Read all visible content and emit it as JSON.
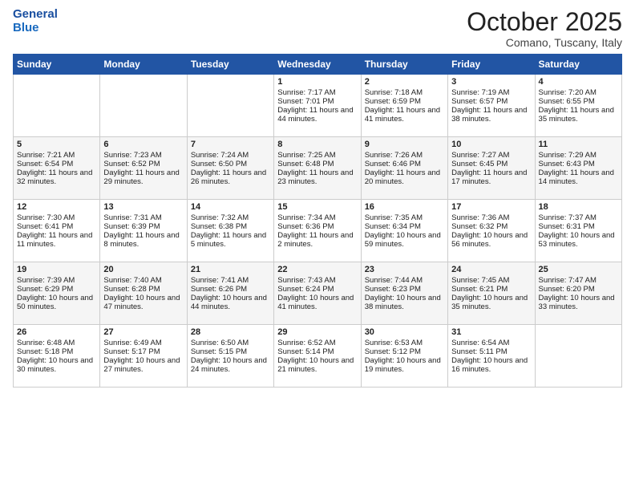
{
  "header": {
    "logo_line1": "General",
    "logo_line2": "Blue",
    "month_title": "October 2025",
    "location": "Comano, Tuscany, Italy"
  },
  "weekdays": [
    "Sunday",
    "Monday",
    "Tuesday",
    "Wednesday",
    "Thursday",
    "Friday",
    "Saturday"
  ],
  "weeks": [
    [
      {
        "day": "",
        "info": ""
      },
      {
        "day": "",
        "info": ""
      },
      {
        "day": "",
        "info": ""
      },
      {
        "day": "1",
        "info": "Sunrise: 7:17 AM\nSunset: 7:01 PM\nDaylight: 11 hours and 44 minutes."
      },
      {
        "day": "2",
        "info": "Sunrise: 7:18 AM\nSunset: 6:59 PM\nDaylight: 11 hours and 41 minutes."
      },
      {
        "day": "3",
        "info": "Sunrise: 7:19 AM\nSunset: 6:57 PM\nDaylight: 11 hours and 38 minutes."
      },
      {
        "day": "4",
        "info": "Sunrise: 7:20 AM\nSunset: 6:55 PM\nDaylight: 11 hours and 35 minutes."
      }
    ],
    [
      {
        "day": "5",
        "info": "Sunrise: 7:21 AM\nSunset: 6:54 PM\nDaylight: 11 hours and 32 minutes."
      },
      {
        "day": "6",
        "info": "Sunrise: 7:23 AM\nSunset: 6:52 PM\nDaylight: 11 hours and 29 minutes."
      },
      {
        "day": "7",
        "info": "Sunrise: 7:24 AM\nSunset: 6:50 PM\nDaylight: 11 hours and 26 minutes."
      },
      {
        "day": "8",
        "info": "Sunrise: 7:25 AM\nSunset: 6:48 PM\nDaylight: 11 hours and 23 minutes."
      },
      {
        "day": "9",
        "info": "Sunrise: 7:26 AM\nSunset: 6:46 PM\nDaylight: 11 hours and 20 minutes."
      },
      {
        "day": "10",
        "info": "Sunrise: 7:27 AM\nSunset: 6:45 PM\nDaylight: 11 hours and 17 minutes."
      },
      {
        "day": "11",
        "info": "Sunrise: 7:29 AM\nSunset: 6:43 PM\nDaylight: 11 hours and 14 minutes."
      }
    ],
    [
      {
        "day": "12",
        "info": "Sunrise: 7:30 AM\nSunset: 6:41 PM\nDaylight: 11 hours and 11 minutes."
      },
      {
        "day": "13",
        "info": "Sunrise: 7:31 AM\nSunset: 6:39 PM\nDaylight: 11 hours and 8 minutes."
      },
      {
        "day": "14",
        "info": "Sunrise: 7:32 AM\nSunset: 6:38 PM\nDaylight: 11 hours and 5 minutes."
      },
      {
        "day": "15",
        "info": "Sunrise: 7:34 AM\nSunset: 6:36 PM\nDaylight: 11 hours and 2 minutes."
      },
      {
        "day": "16",
        "info": "Sunrise: 7:35 AM\nSunset: 6:34 PM\nDaylight: 10 hours and 59 minutes."
      },
      {
        "day": "17",
        "info": "Sunrise: 7:36 AM\nSunset: 6:32 PM\nDaylight: 10 hours and 56 minutes."
      },
      {
        "day": "18",
        "info": "Sunrise: 7:37 AM\nSunset: 6:31 PM\nDaylight: 10 hours and 53 minutes."
      }
    ],
    [
      {
        "day": "19",
        "info": "Sunrise: 7:39 AM\nSunset: 6:29 PM\nDaylight: 10 hours and 50 minutes."
      },
      {
        "day": "20",
        "info": "Sunrise: 7:40 AM\nSunset: 6:28 PM\nDaylight: 10 hours and 47 minutes."
      },
      {
        "day": "21",
        "info": "Sunrise: 7:41 AM\nSunset: 6:26 PM\nDaylight: 10 hours and 44 minutes."
      },
      {
        "day": "22",
        "info": "Sunrise: 7:43 AM\nSunset: 6:24 PM\nDaylight: 10 hours and 41 minutes."
      },
      {
        "day": "23",
        "info": "Sunrise: 7:44 AM\nSunset: 6:23 PM\nDaylight: 10 hours and 38 minutes."
      },
      {
        "day": "24",
        "info": "Sunrise: 7:45 AM\nSunset: 6:21 PM\nDaylight: 10 hours and 35 minutes."
      },
      {
        "day": "25",
        "info": "Sunrise: 7:47 AM\nSunset: 6:20 PM\nDaylight: 10 hours and 33 minutes."
      }
    ],
    [
      {
        "day": "26",
        "info": "Sunrise: 6:48 AM\nSunset: 5:18 PM\nDaylight: 10 hours and 30 minutes."
      },
      {
        "day": "27",
        "info": "Sunrise: 6:49 AM\nSunset: 5:17 PM\nDaylight: 10 hours and 27 minutes."
      },
      {
        "day": "28",
        "info": "Sunrise: 6:50 AM\nSunset: 5:15 PM\nDaylight: 10 hours and 24 minutes."
      },
      {
        "day": "29",
        "info": "Sunrise: 6:52 AM\nSunset: 5:14 PM\nDaylight: 10 hours and 21 minutes."
      },
      {
        "day": "30",
        "info": "Sunrise: 6:53 AM\nSunset: 5:12 PM\nDaylight: 10 hours and 19 minutes."
      },
      {
        "day": "31",
        "info": "Sunrise: 6:54 AM\nSunset: 5:11 PM\nDaylight: 10 hours and 16 minutes."
      },
      {
        "day": "",
        "info": ""
      }
    ]
  ]
}
